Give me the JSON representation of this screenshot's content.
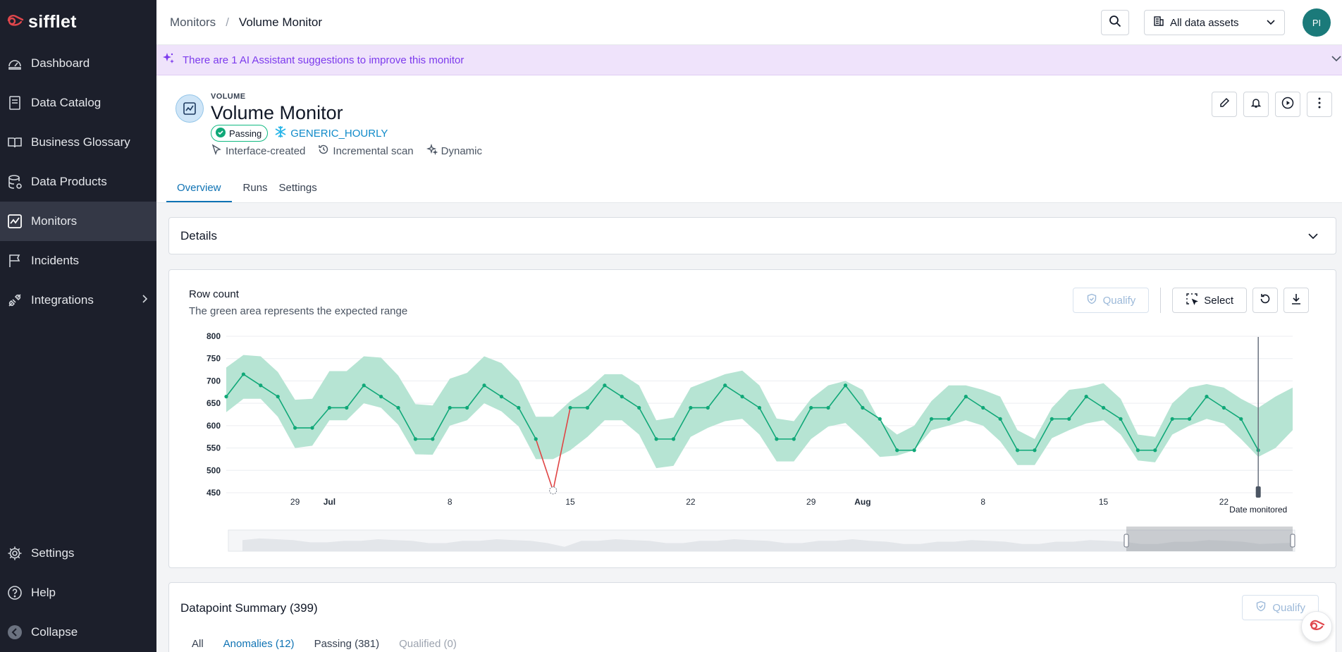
{
  "app": {
    "name": "sifflet"
  },
  "sidebar": {
    "items": [
      {
        "label": "Dashboard",
        "icon": "dashboard-icon"
      },
      {
        "label": "Data Catalog",
        "icon": "catalog-icon"
      },
      {
        "label": "Business Glossary",
        "icon": "book-icon"
      },
      {
        "label": "Data Products",
        "icon": "database-icon"
      },
      {
        "label": "Monitors",
        "icon": "monitor-icon",
        "active": true
      },
      {
        "label": "Incidents",
        "icon": "flag-icon"
      },
      {
        "label": "Integrations",
        "icon": "plug-icon"
      }
    ],
    "bottom": [
      {
        "label": "Settings",
        "icon": "gear-icon"
      },
      {
        "label": "Help",
        "icon": "help-icon"
      },
      {
        "label": "Collapse",
        "icon": "collapse-icon"
      }
    ]
  },
  "topbar": {
    "breadcrumb_parent": "Monitors",
    "breadcrumb_separator": "/",
    "breadcrumb_current": "Volume Monitor",
    "asset_filter": "All data assets",
    "avatar_initials": "PI"
  },
  "ai_banner": {
    "text": "There are 1 AI Assistant suggestions to improve this monitor"
  },
  "monitor": {
    "type": "VOLUME",
    "title": "Volume Monitor",
    "status": "Passing",
    "schedule": "GENERIC_HOURLY",
    "meta": [
      "Interface-created",
      "Incremental scan",
      "Dynamic"
    ],
    "tabs": [
      "Overview",
      "Runs",
      "Settings"
    ]
  },
  "details": {
    "label": "Details"
  },
  "chart_card": {
    "title": "Row count",
    "subtitle": "The green area represents the expected range",
    "qualify_label": "Qualify",
    "select_label": "Select",
    "date_marker_label": "Date monitored"
  },
  "summary": {
    "title": "Datapoint Summary (399)",
    "qualify_label": "Qualify",
    "tabs": [
      "All",
      "Anomalies (12)",
      "Passing (381)",
      "Qualified (0)"
    ]
  },
  "colors": {
    "accent": "#0f73b4",
    "band": "#b6e4d3",
    "line": "#10a878",
    "anomaly": "#e04444",
    "sidebar": "#1c1f2b"
  },
  "chart_data": {
    "type": "line",
    "title": "Row count",
    "ylim": [
      450,
      800
    ],
    "y_ticks": [
      450,
      500,
      550,
      600,
      650,
      700,
      750,
      800
    ],
    "x_tick_labels": [
      {
        "day": 0,
        "label": "29"
      },
      {
        "day": 2,
        "label": "Jul",
        "bold": true
      },
      {
        "day": 9,
        "label": "8"
      },
      {
        "day": 16,
        "label": "15"
      },
      {
        "day": 23,
        "label": "22"
      },
      {
        "day": 30,
        "label": "29"
      },
      {
        "day": 33,
        "label": "Aug",
        "bold": true
      },
      {
        "day": 40,
        "label": "8"
      },
      {
        "day": 47,
        "label": "15"
      },
      {
        "day": 54,
        "label": "22"
      }
    ],
    "series": [
      {
        "values": [
          {
            "day": -4,
            "value": 665
          },
          {
            "day": -3,
            "value": 715
          },
          {
            "day": -2,
            "value": 690
          },
          {
            "day": -1,
            "value": 665
          },
          {
            "day": 0,
            "value": 595
          },
          {
            "day": 1,
            "value": 595
          },
          {
            "day": 2,
            "value": 640
          },
          {
            "day": 3,
            "value": 640
          },
          {
            "day": 4,
            "value": 690
          },
          {
            "day": 5,
            "value": 665
          },
          {
            "day": 6,
            "value": 640
          },
          {
            "day": 7,
            "value": 570
          },
          {
            "day": 8,
            "value": 570
          },
          {
            "day": 9,
            "value": 640
          },
          {
            "day": 10,
            "value": 640
          },
          {
            "day": 11,
            "value": 690
          },
          {
            "day": 12,
            "value": 665
          },
          {
            "day": 13,
            "value": 640
          },
          {
            "day": 14,
            "value": 570
          },
          {
            "day": 15,
            "value": 455,
            "anomaly": true
          },
          {
            "day": 16,
            "value": 640
          },
          {
            "day": 17,
            "value": 640
          },
          {
            "day": 18,
            "value": 690
          },
          {
            "day": 19,
            "value": 665
          },
          {
            "day": 20,
            "value": 640
          },
          {
            "day": 21,
            "value": 570
          },
          {
            "day": 22,
            "value": 570
          },
          {
            "day": 23,
            "value": 640
          },
          {
            "day": 24,
            "value": 640
          },
          {
            "day": 25,
            "value": 690
          },
          {
            "day": 26,
            "value": 665
          },
          {
            "day": 27,
            "value": 640
          },
          {
            "day": 28,
            "value": 570
          },
          {
            "day": 29,
            "value": 570
          },
          {
            "day": 30,
            "value": 640
          },
          {
            "day": 31,
            "value": 640
          },
          {
            "day": 32,
            "value": 690
          },
          {
            "day": 33,
            "value": 640
          },
          {
            "day": 34,
            "value": 615
          },
          {
            "day": 35,
            "value": 545
          },
          {
            "day": 36,
            "value": 545
          },
          {
            "day": 37,
            "value": 615
          },
          {
            "day": 38,
            "value": 615
          },
          {
            "day": 39,
            "value": 665
          },
          {
            "day": 40,
            "value": 640
          },
          {
            "day": 41,
            "value": 615
          },
          {
            "day": 42,
            "value": 545
          },
          {
            "day": 43,
            "value": 545
          },
          {
            "day": 44,
            "value": 615
          },
          {
            "day": 45,
            "value": 615
          },
          {
            "day": 46,
            "value": 665
          },
          {
            "day": 47,
            "value": 640
          },
          {
            "day": 48,
            "value": 615
          },
          {
            "day": 49,
            "value": 545
          },
          {
            "day": 50,
            "value": 545
          },
          {
            "day": 51,
            "value": 615
          },
          {
            "day": 52,
            "value": 615
          },
          {
            "day": 53,
            "value": 665
          },
          {
            "day": 54,
            "value": 640
          },
          {
            "day": 55,
            "value": 615
          },
          {
            "day": 56,
            "value": 545
          }
        ]
      }
    ],
    "expected_range": {
      "upper": [
        [
          -4,
          730
        ],
        [
          -3,
          758
        ],
        [
          -2,
          755
        ],
        [
          -1,
          720
        ],
        [
          0,
          658
        ],
        [
          1,
          660
        ],
        [
          2,
          722
        ],
        [
          3,
          722
        ],
        [
          4,
          755
        ],
        [
          5,
          752
        ],
        [
          6,
          712
        ],
        [
          7,
          648
        ],
        [
          8,
          645
        ],
        [
          9,
          705
        ],
        [
          10,
          718
        ],
        [
          11,
          755
        ],
        [
          12,
          740
        ],
        [
          13,
          700
        ],
        [
          14,
          620
        ],
        [
          15,
          620
        ],
        [
          16,
          655
        ],
        [
          17,
          680
        ],
        [
          18,
          715
        ],
        [
          19,
          715
        ],
        [
          20,
          690
        ],
        [
          21,
          612
        ],
        [
          22,
          618
        ],
        [
          23,
          685
        ],
        [
          24,
          700
        ],
        [
          25,
          715
        ],
        [
          26,
          723
        ],
        [
          27,
          690
        ],
        [
          28,
          616
        ],
        [
          29,
          610
        ],
        [
          30,
          660
        ],
        [
          31,
          690
        ],
        [
          32,
          700
        ],
        [
          33,
          680
        ],
        [
          34,
          610
        ],
        [
          35,
          580
        ],
        [
          36,
          600
        ],
        [
          37,
          655
        ],
        [
          38,
          690
        ],
        [
          39,
          690
        ],
        [
          40,
          680
        ],
        [
          41,
          665
        ],
        [
          42,
          590
        ],
        [
          43,
          570
        ],
        [
          44,
          640
        ],
        [
          45,
          680
        ],
        [
          46,
          685
        ],
        [
          47,
          695
        ],
        [
          48,
          660
        ],
        [
          49,
          580
        ],
        [
          50,
          575
        ],
        [
          51,
          650
        ],
        [
          52,
          685
        ],
        [
          53,
          693
        ],
        [
          54,
          685
        ],
        [
          55,
          660
        ],
        [
          56,
          640
        ],
        [
          57,
          665
        ],
        [
          58,
          685
        ]
      ],
      "lower": [
        [
          -4,
          630
        ],
        [
          -3,
          660
        ],
        [
          -2,
          660
        ],
        [
          -1,
          620
        ],
        [
          0,
          550
        ],
        [
          1,
          555
        ],
        [
          2,
          612
        ],
        [
          3,
          612
        ],
        [
          4,
          650
        ],
        [
          5,
          640
        ],
        [
          6,
          602
        ],
        [
          7,
          536
        ],
        [
          8,
          535
        ],
        [
          9,
          600
        ],
        [
          10,
          612
        ],
        [
          11,
          650
        ],
        [
          12,
          632
        ],
        [
          13,
          598
        ],
        [
          14,
          525
        ],
        [
          15,
          525
        ],
        [
          16,
          545
        ],
        [
          17,
          575
        ],
        [
          18,
          612
        ],
        [
          19,
          612
        ],
        [
          20,
          580
        ],
        [
          21,
          505
        ],
        [
          22,
          510
        ],
        [
          23,
          575
        ],
        [
          24,
          595
        ],
        [
          25,
          610
        ],
        [
          26,
          615
        ],
        [
          27,
          580
        ],
        [
          28,
          520
        ],
        [
          29,
          520
        ],
        [
          30,
          570
        ],
        [
          31,
          598
        ],
        [
          32,
          606
        ],
        [
          33,
          570
        ],
        [
          34,
          530
        ],
        [
          35,
          533
        ],
        [
          36,
          545
        ],
        [
          37,
          590
        ],
        [
          38,
          600
        ],
        [
          39,
          612
        ],
        [
          40,
          600
        ],
        [
          41,
          565
        ],
        [
          42,
          512
        ],
        [
          43,
          512
        ],
        [
          44,
          572
        ],
        [
          45,
          590
        ],
        [
          46,
          605
        ],
        [
          47,
          612
        ],
        [
          48,
          580
        ],
        [
          49,
          522
        ],
        [
          50,
          518
        ],
        [
          51,
          580
        ],
        [
          52,
          600
        ],
        [
          53,
          615
        ],
        [
          54,
          605
        ],
        [
          55,
          570
        ],
        [
          56,
          530
        ],
        [
          57,
          550
        ],
        [
          58,
          590
        ]
      ]
    },
    "date_monitored_day": 56,
    "x_range": [
      -4,
      58
    ]
  }
}
